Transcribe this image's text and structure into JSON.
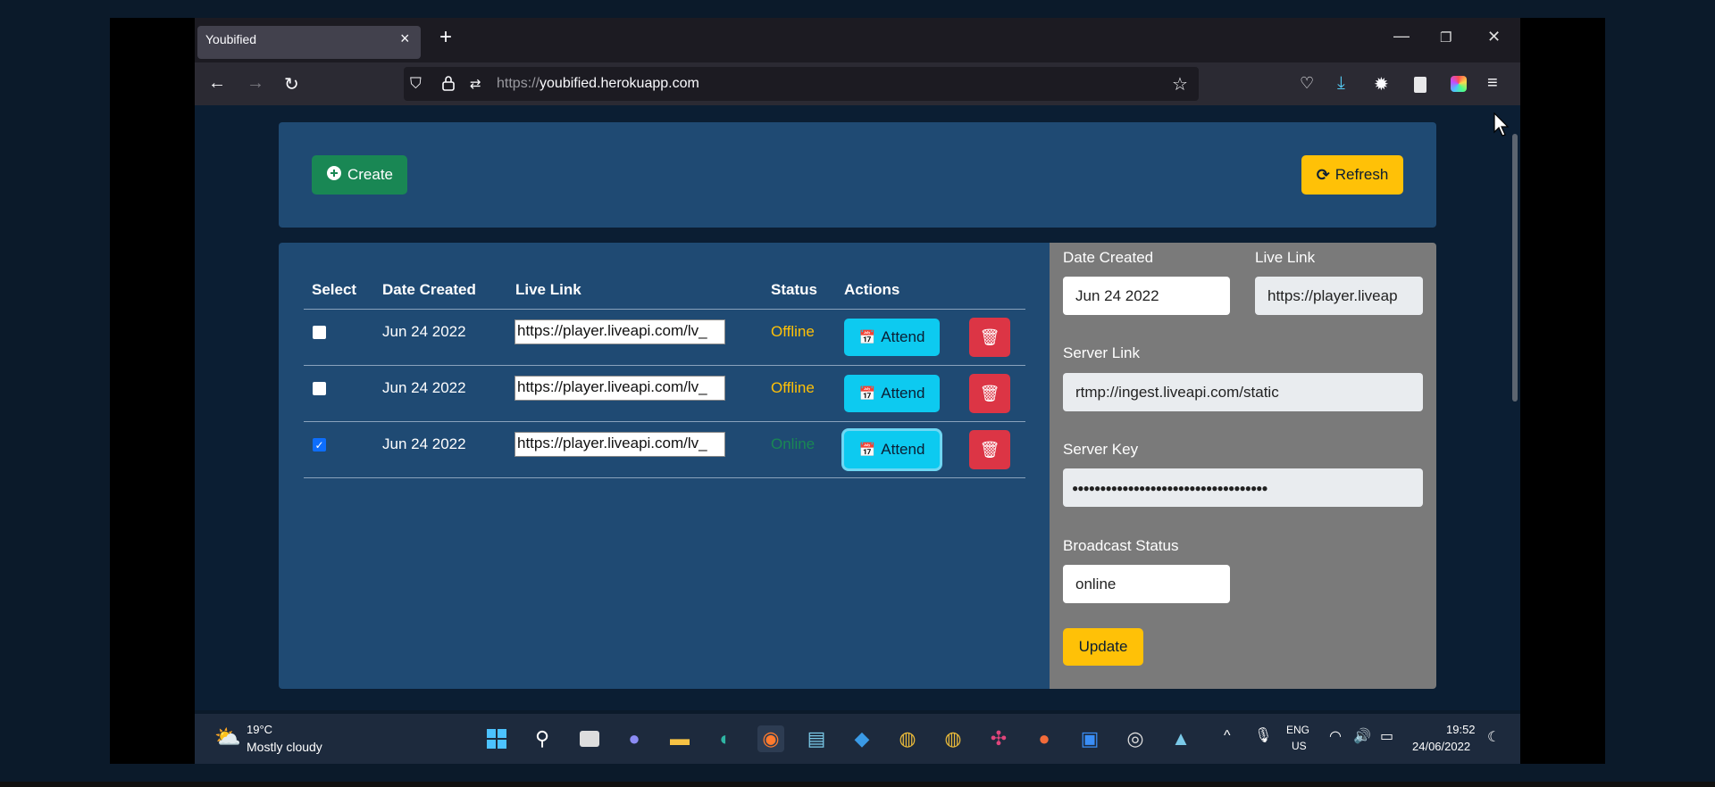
{
  "browser": {
    "tab_title": "Youbified",
    "tab_close": "×",
    "new_tab": "+",
    "url_protocol": "https://",
    "url_host": "youbified.herokuapp.com",
    "window_min": "—",
    "window_restore": "❐",
    "window_close": "✕"
  },
  "toolbar": {
    "create_label": "Create",
    "refresh_label": "Refresh"
  },
  "table": {
    "headers": {
      "select": "Select",
      "date_created": "Date Created",
      "live_link": "Live Link",
      "status": "Status",
      "actions": "Actions"
    },
    "rows": [
      {
        "checked": false,
        "date": "Jun 24 2022",
        "link": "https://player.liveapi.com/lv_",
        "status": "Offline",
        "attend": "Attend"
      },
      {
        "checked": false,
        "date": "Jun 24 2022",
        "link": "https://player.liveapi.com/lv_",
        "status": "Offline",
        "attend": "Attend"
      },
      {
        "checked": true,
        "date": "Jun 24 2022",
        "link": "https://player.liveapi.com/lv_",
        "status": "Online",
        "attend": "Attend"
      }
    ]
  },
  "detail": {
    "date_created_label": "Date Created",
    "date_created_value": "Jun 24 2022",
    "live_link_label": "Live Link",
    "live_link_value": "https://player.liveap",
    "server_link_label": "Server Link",
    "server_link_value": "rtmp://ingest.liveapi.com/static",
    "server_key_label": "Server Key",
    "server_key_value": "●●●●●●●●●●●●●●●●●●●●●●●●●●●●●●●●●●●",
    "broadcast_status_label": "Broadcast Status",
    "broadcast_status_value": "online",
    "update_label": "Update"
  },
  "taskbar": {
    "weather_temp": "19°C",
    "weather_desc": "Mostly cloudy",
    "lang_line1": "ENG",
    "lang_line2": "US",
    "time": "19:52",
    "date": "24/06/2022"
  },
  "colors": {
    "offline": "#ffc107",
    "online": "#198754",
    "panel": "#1f4a73",
    "detail_panel": "#7a7a7a"
  }
}
